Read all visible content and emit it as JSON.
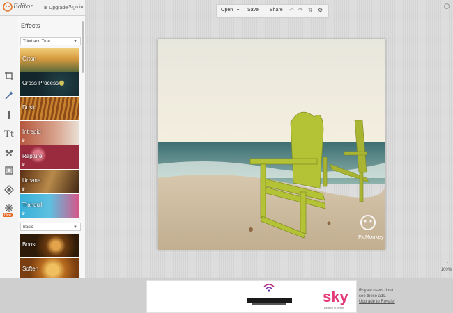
{
  "app": {
    "title": "Editor"
  },
  "topbar": {
    "upgrade_label": "Upgrade",
    "signin_label": "Sign in"
  },
  "rail": {
    "tools": [
      "crop-icon",
      "wand-icon",
      "brush-icon",
      "text-icon",
      "butterfly-icon",
      "frame-icon",
      "texture-icon",
      "snowflake-icon"
    ],
    "new_badge": "New"
  },
  "panel": {
    "title": "Effects",
    "category_1": "Tried and True",
    "category_2": "Basic",
    "effects": [
      {
        "label": "Orton",
        "colors": [
          "#6b7a45",
          "#d7a24a"
        ]
      },
      {
        "label": "Cross Process",
        "colors": [
          "#1d4e5a",
          "#4a7d6b"
        ]
      },
      {
        "label": "Dusk",
        "colors": [
          "#6d3a12",
          "#c27a2c"
        ]
      },
      {
        "label": "Intrepid",
        "colors": [
          "#a44a36",
          "#d19a84"
        ]
      },
      {
        "label": "Rapture",
        "colors": [
          "#8a2b3a",
          "#e07a89"
        ]
      },
      {
        "label": "Urbane",
        "colors": [
          "#6b3a1a",
          "#c9a064"
        ]
      },
      {
        "label": "Tranquil",
        "colors": [
          "#3aa0c7",
          "#d45a86"
        ]
      }
    ],
    "basic_effects": [
      {
        "label": "Boost",
        "colors": [
          "#4a2a0a",
          "#d08a2a"
        ]
      },
      {
        "label": "Soften",
        "colors": [
          "#a65e1a",
          "#e4b060"
        ]
      }
    ]
  },
  "toolbar": {
    "open_label": "Open",
    "save_label": "Save",
    "share_label": "Share"
  },
  "photo": {
    "watermark": "PicMonkey"
  },
  "zoom": {
    "minus": "-",
    "level": "100%"
  },
  "ad": {
    "brand": "sky",
    "tagline": "Believe in better",
    "text_1": "Royale users don't",
    "text_2": "see these ads.",
    "upgrade_link": "Upgrade to Royale!"
  }
}
